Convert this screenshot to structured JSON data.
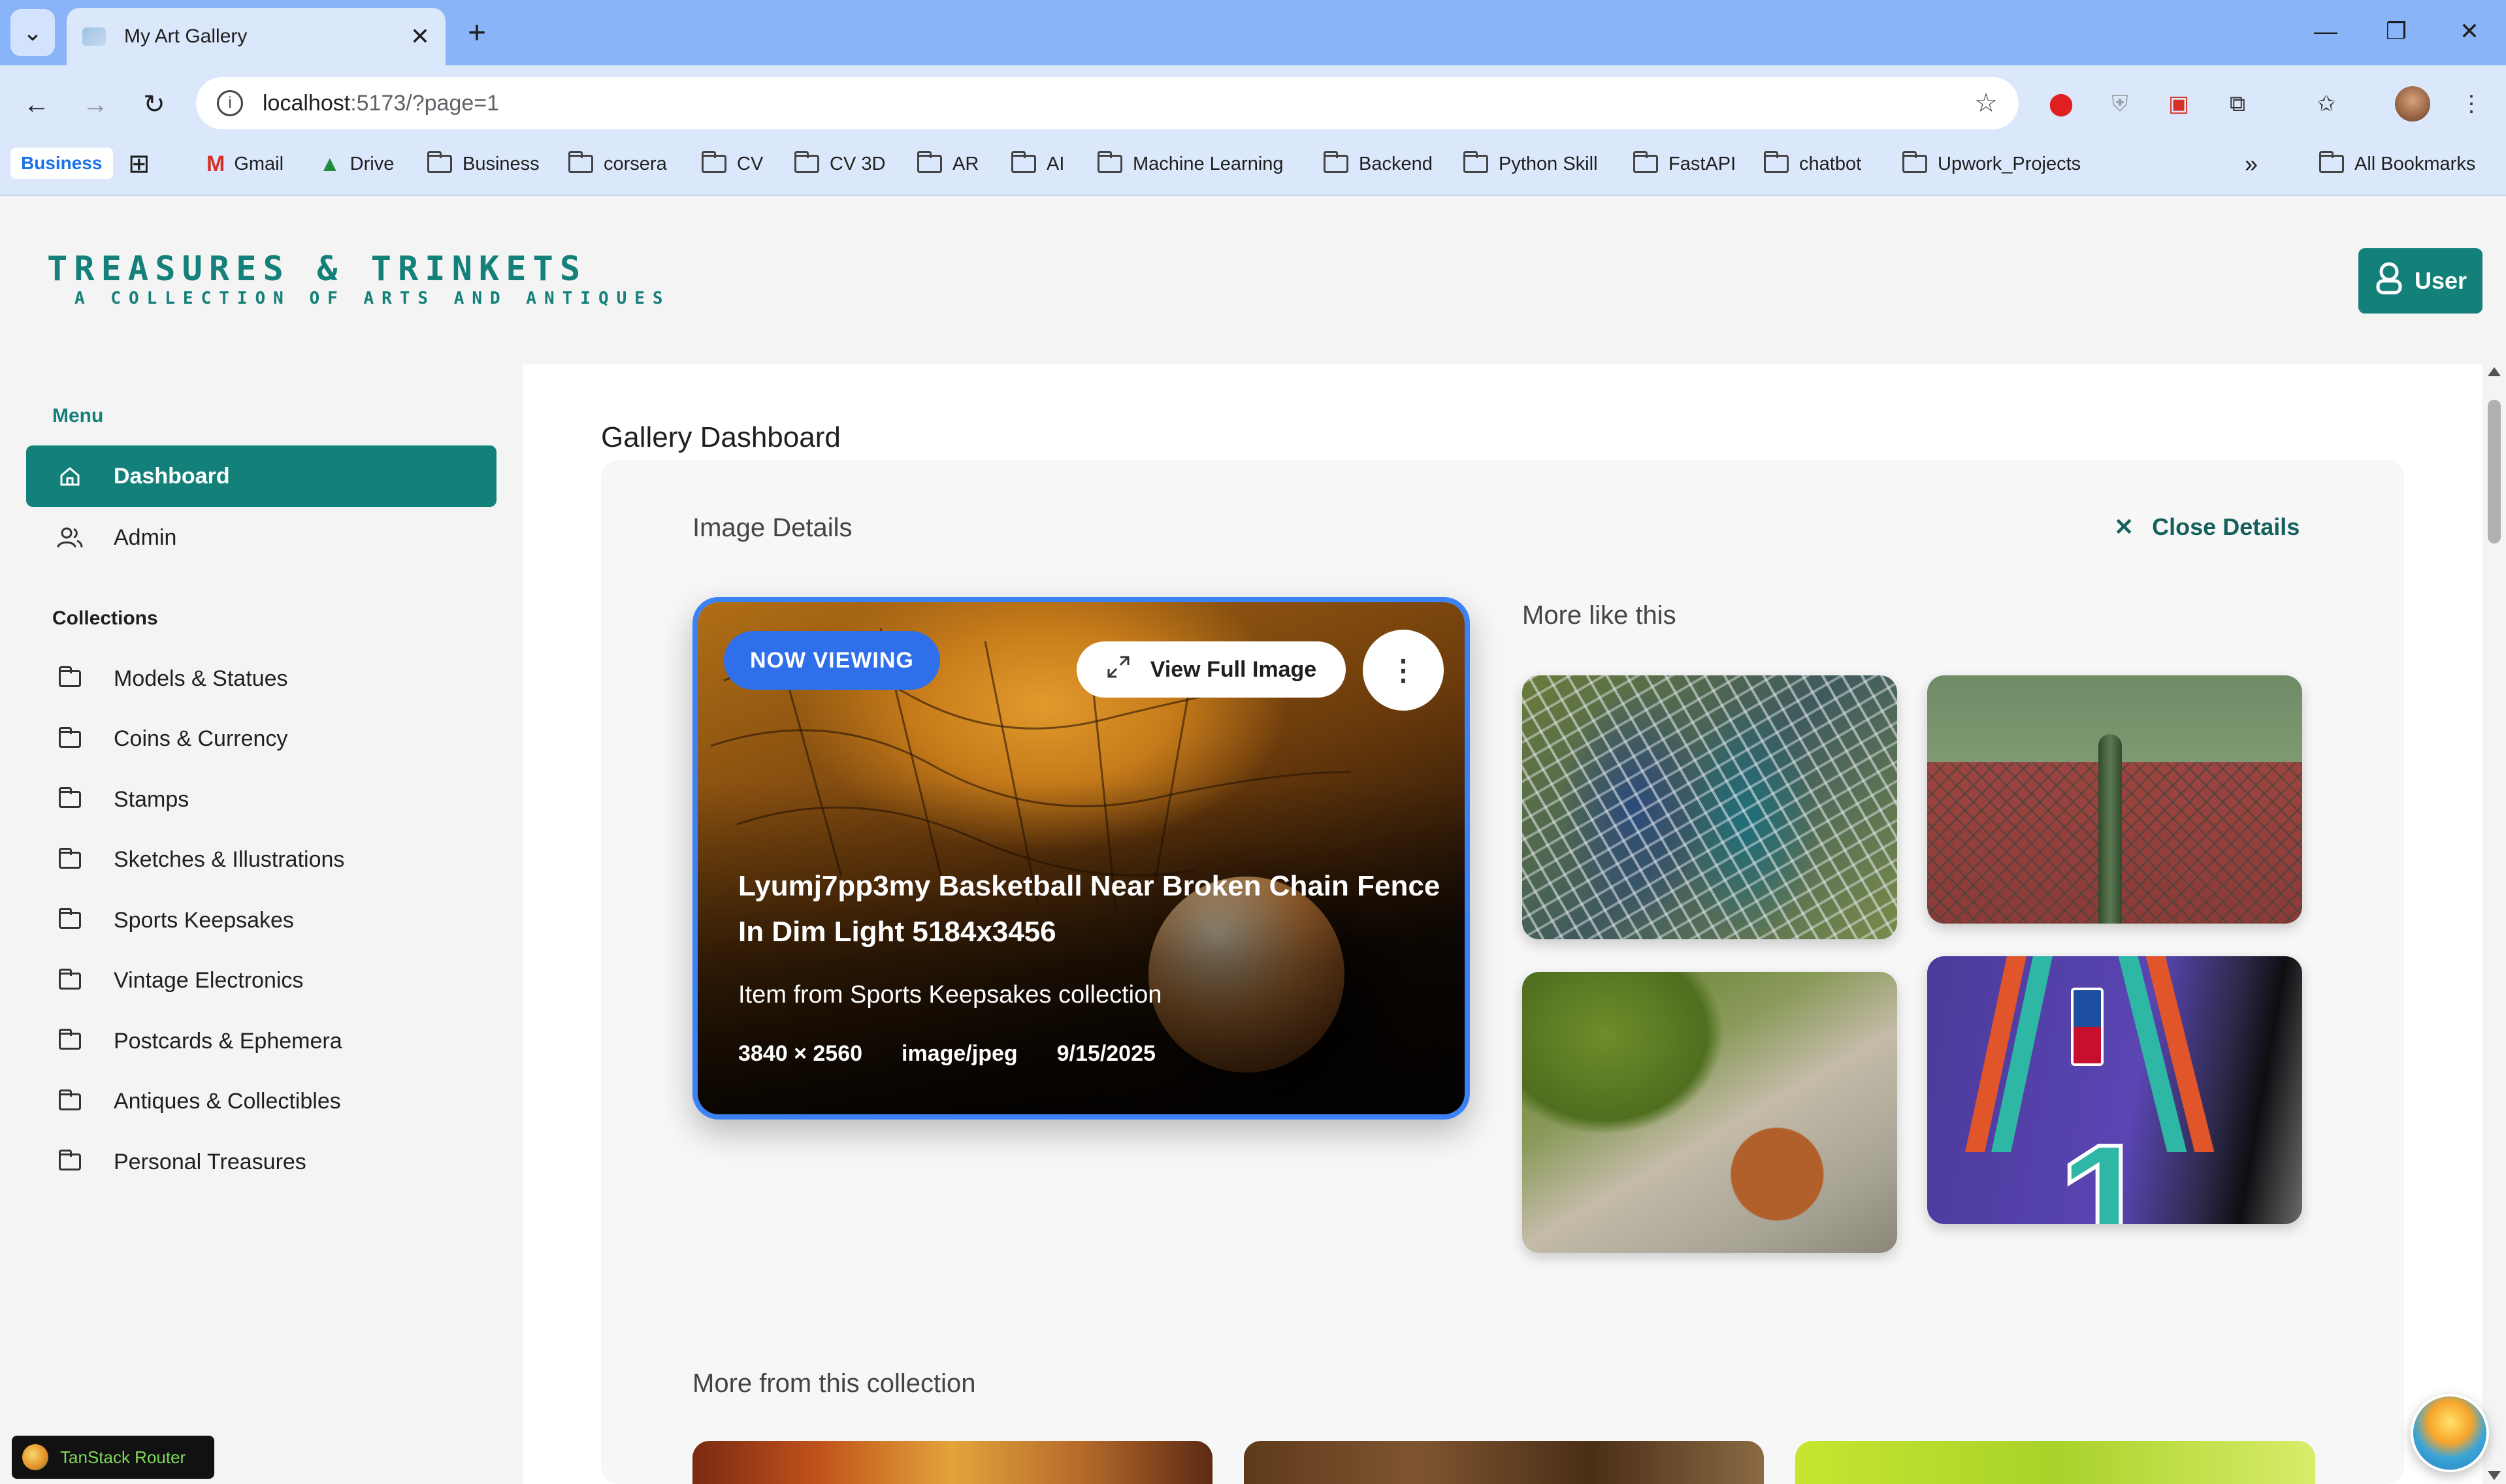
{
  "browser": {
    "tab_title": "My Art Gallery",
    "url_host": "localhost",
    "url_path": ":5173/?page=1",
    "bookmarks": [
      {
        "label": "Gmail",
        "icon": "gmail-icon"
      },
      {
        "label": "Drive",
        "icon": "drive-icon"
      },
      {
        "label": "Business",
        "icon": "folder-icon"
      },
      {
        "label": "corsera",
        "icon": "folder-icon"
      },
      {
        "label": "CV",
        "icon": "folder-icon"
      },
      {
        "label": "CV 3D",
        "icon": "folder-icon"
      },
      {
        "label": "AR",
        "icon": "folder-icon"
      },
      {
        "label": "AI",
        "icon": "folder-icon"
      },
      {
        "label": "Machine Learning",
        "icon": "folder-icon"
      },
      {
        "label": "Backend",
        "icon": "folder-icon"
      },
      {
        "label": "Python Skill",
        "icon": "folder-icon"
      },
      {
        "label": "FastAPI",
        "icon": "folder-icon"
      },
      {
        "label": "chatbot",
        "icon": "folder-icon"
      },
      {
        "label": "Upwork_Projects",
        "icon": "folder-icon"
      }
    ],
    "business_chip": "Business",
    "all_bookmarks": "All Bookmarks"
  },
  "header": {
    "logo_title": "TREASURES & TRINKETS",
    "logo_subtitle": "A COLLECTION OF ARTS AND ANTIQUES",
    "user_button": "User"
  },
  "sidebar": {
    "menu_heading": "Menu",
    "menu_items": [
      {
        "label": "Dashboard",
        "icon": "home-icon",
        "active": true
      },
      {
        "label": "Admin",
        "icon": "users-icon",
        "active": false
      }
    ],
    "collections_heading": "Collections",
    "collections": [
      "Models & Statues",
      "Coins & Currency",
      "Stamps",
      "Sketches & Illustrations",
      "Sports Keepsakes",
      "Vintage Electronics",
      "Postcards & Ephemera",
      "Antiques & Collectibles",
      "Personal Treasures"
    ],
    "devtools_label": "TanStack Router"
  },
  "main": {
    "page_title": "Gallery Dashboard",
    "details_label": "Image Details",
    "close_details": "Close Details",
    "hero": {
      "badge": "NOW VIEWING",
      "view_full": "View Full Image",
      "title": "Lyumj7pp3my Basketball Near Broken Chain Fence In Dim Light 5184x3456",
      "subtitle": "Item from Sports Keepsakes collection",
      "dimensions": "3840 × 2560",
      "mime": "image/jpeg",
      "date": "9/15/2025"
    },
    "more_like_this": "More like this",
    "more_from_collection": "More from this collection"
  },
  "colors": {
    "brand": "#14807a",
    "badge": "#2f6fea",
    "hero_border": "#3b82f6"
  }
}
